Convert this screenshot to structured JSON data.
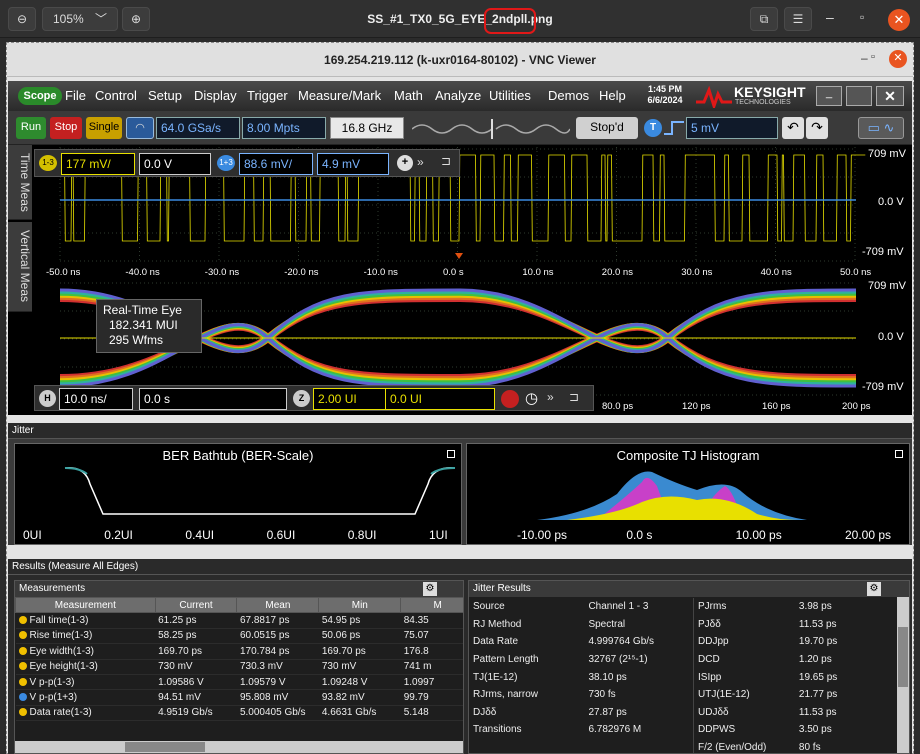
{
  "outer": {
    "zoom": "105%",
    "title": "SS_#1_TX0_5G_EYE_2ndpll.png"
  },
  "vnc": {
    "title": "169.254.219.112 (k-uxr0164-80102) - VNC Viewer"
  },
  "menubar": {
    "logo": "Scope",
    "items": [
      "File",
      "Control",
      "Setup",
      "Display",
      "Trigger",
      "Measure/Mark",
      "Math",
      "Analyze",
      "Utilities",
      "Demos",
      "Help"
    ],
    "time": "1:45 PM",
    "date": "6/6/2024",
    "brand": "KEYSIGHT",
    "brand_sub": "TECHNOLOGIES"
  },
  "toolbar": {
    "run": "Run",
    "stop": "Stop",
    "single": "Single",
    "sample_rate": "64.0 GSa/s",
    "memory": "8.00 Mpts",
    "bandwidth": "16.8 GHz",
    "status": "Stop'd",
    "trigger_badge": "T",
    "trigger_level": "5 mV"
  },
  "channels": {
    "ch_a_badge": "1-3",
    "ch_a_scale": "177 mV/",
    "ch_a_offset": "0.0 V",
    "ch_b_badge": "1+3",
    "ch_b_scale": "88.6 mV/",
    "ch_b_offset": "4.9 mV"
  },
  "side_tabs": [
    "Time Meas",
    "Vertical Meas"
  ],
  "waveform": {
    "y_top": "709 mV",
    "y_mid": "0.0 V",
    "y_bot": "-709 mV",
    "x_ticks": [
      "-50.0 ns",
      "-40.0 ns",
      "-30.0 ns",
      "-20.0 ns",
      "-10.0 ns",
      "0.0 s",
      "10.0 ns",
      "20.0 ns",
      "30.0 ns",
      "40.0 ns",
      "50.0 ns"
    ]
  },
  "eye": {
    "y_top": "709 mV",
    "y_mid": "0.0 V",
    "y_bot": "-709 mV",
    "label_title": "Real-Time Eye",
    "label_mui": "182.341 MUI",
    "label_wfms": "295 Wfms",
    "x_ticks": [
      "80.0 ps",
      "120 ps",
      "160 ps",
      "200 ps"
    ]
  },
  "timebase": {
    "h_badge": "H",
    "scale": "10.0 ns/",
    "delay": "0.0 s",
    "z_badge": "Z",
    "ui_scale": "2.00 UI",
    "ui_pos": "0.0 UI"
  },
  "jitter": {
    "panel_title": "Jitter",
    "bathtub": {
      "title": "BER Bathtub (BER-Scale)",
      "x_labels": [
        "0UI",
        "0.2UI",
        "0.4UI",
        "0.6UI",
        "0.8UI",
        "1UI"
      ]
    },
    "histogram": {
      "title": "Composite TJ Histogram",
      "x_labels": [
        "-10.00 ps",
        "0.0 s",
        "10.00 ps",
        "20.00 ps"
      ]
    }
  },
  "results": {
    "panel_title": "Results  (Measure All Edges)",
    "measurements_title": "Measurements",
    "columns": [
      "Measurement",
      "Current",
      "Mean",
      "Min",
      "M"
    ],
    "rows": [
      {
        "color": "#f0c000",
        "name": "Fall time(1-3)",
        "current": "61.25 ps",
        "mean": "67.8817 ps",
        "min": "54.95 ps",
        "max": "84.35"
      },
      {
        "color": "#f0c000",
        "name": "Rise time(1-3)",
        "current": "58.25 ps",
        "mean": "60.0515 ps",
        "min": "50.06 ps",
        "max": "75.07"
      },
      {
        "color": "#f0c000",
        "name": "Eye width(1-3)",
        "current": "169.70 ps",
        "mean": "170.784 ps",
        "min": "169.70 ps",
        "max": "176.8"
      },
      {
        "color": "#f0c000",
        "name": "Eye height(1-3)",
        "current": "730 mV",
        "mean": "730.3 mV",
        "min": "730 mV",
        "max": "741 m"
      },
      {
        "color": "#f0c000",
        "name": "V p-p(1-3)",
        "current": "1.09586 V",
        "mean": "1.09579 V",
        "min": "1.09248 V",
        "max": "1.0997"
      },
      {
        "color": "#3a8ae0",
        "name": "V p-p(1+3)",
        "current": "94.51 mV",
        "mean": "95.808 mV",
        "min": "93.82 mV",
        "max": "99.79"
      },
      {
        "color": "#f0c000",
        "name": "Data rate(1-3)",
        "current": "4.9519 Gb/s",
        "mean": "5.000405 Gb/s",
        "min": "4.6631 Gb/s",
        "max": "5.148"
      }
    ],
    "jitter_results_title": "Jitter Results",
    "jitter_left": [
      {
        "k": "Source",
        "v": "Channel 1 - 3"
      },
      {
        "k": "RJ Method",
        "v": "Spectral"
      },
      {
        "k": "Data Rate",
        "v": "4.999764 Gb/s"
      },
      {
        "k": "Pattern Length",
        "v": "32767 (2¹⁵-1)"
      },
      {
        "k": "TJ(1E-12)",
        "v": "38.10 ps"
      },
      {
        "k": "RJrms, narrow",
        "v": "730 fs"
      },
      {
        "k": "DJδδ",
        "v": "27.87 ps"
      },
      {
        "k": "Transitions",
        "v": "6.782976 M"
      }
    ],
    "jitter_right": [
      {
        "k": "PJrms",
        "v": "3.98 ps"
      },
      {
        "k": "PJδδ",
        "v": "11.53 ps"
      },
      {
        "k": "DDJpp",
        "v": "19.70 ps"
      },
      {
        "k": "DCD",
        "v": "1.20 ps"
      },
      {
        "k": "ISIpp",
        "v": "19.65 ps"
      },
      {
        "k": "UTJ(1E-12)",
        "v": "21.77 ps"
      },
      {
        "k": "UDJδδ",
        "v": "11.53 ps"
      },
      {
        "k": "DDPWS",
        "v": "3.50 ps"
      },
      {
        "k": "F/2 (Even/Odd)",
        "v": "80 fs"
      }
    ]
  }
}
